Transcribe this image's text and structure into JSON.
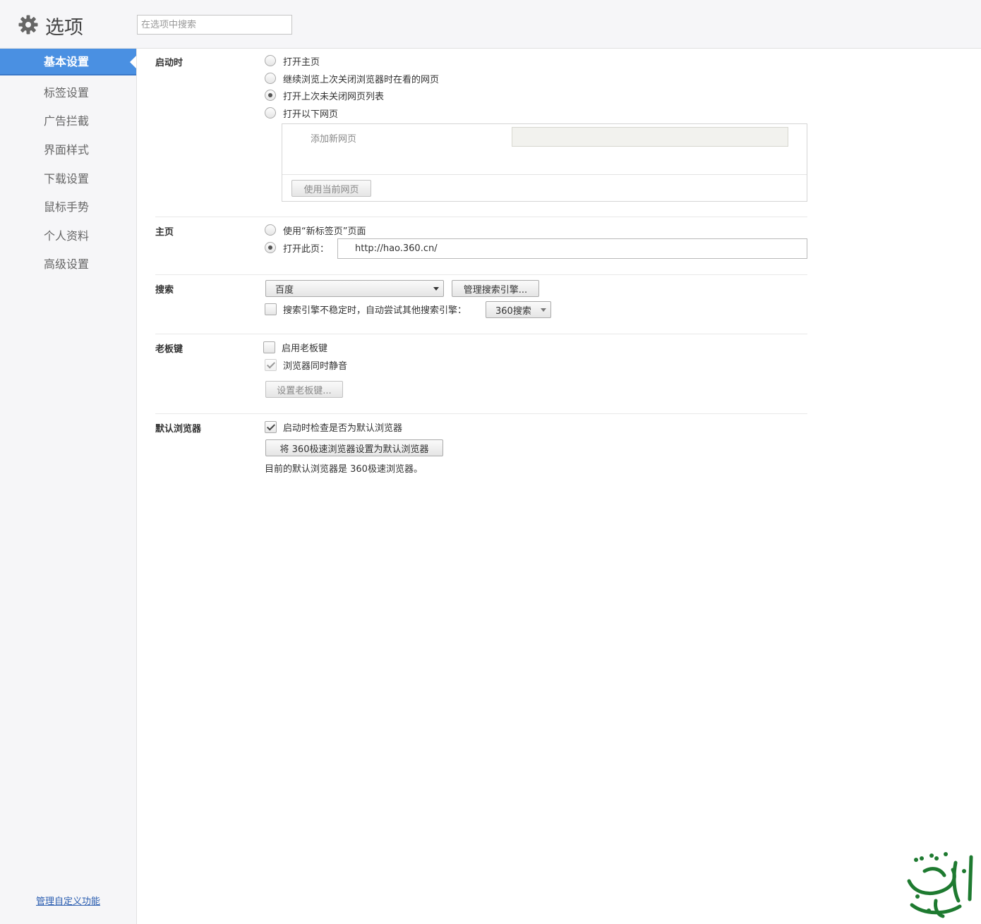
{
  "header": {
    "title": "选项",
    "search_placeholder": "在选项中搜索"
  },
  "sidebar": {
    "items": [
      {
        "label": "基本设置",
        "active": true
      },
      {
        "label": "标签设置"
      },
      {
        "label": "广告拦截"
      },
      {
        "label": "界面样式"
      },
      {
        "label": "下载设置"
      },
      {
        "label": "鼠标手势"
      },
      {
        "label": "个人资料"
      },
      {
        "label": "高级设置"
      }
    ],
    "manage_link": "管理自定义功能"
  },
  "startup": {
    "title": "启动时",
    "options": [
      "打开主页",
      "继续浏览上次关闭浏览器时在看的网页",
      "打开上次未关闭网页列表",
      "打开以下网页"
    ],
    "selected_option": "打开上次未关闭网页列表",
    "add_page_label": "添加新网页",
    "use_current_button": "使用当前网页"
  },
  "homepage": {
    "title": "主页",
    "option_newtab": "使用“新标签页”页面",
    "option_open": "打开此页：",
    "selected_option": "打开此页：",
    "url": "http://hao.360.cn/"
  },
  "search": {
    "title": "搜索",
    "engine": "百度",
    "manage_button": "管理搜索引擎...",
    "fallback_label": "搜索引擎不稳定时，自动尝试其他搜索引擎：",
    "fallback_checked": false,
    "fallback_engine": "360搜索"
  },
  "boss_key": {
    "title": "老板键",
    "enable_label": "启用老板键",
    "enable_checked": false,
    "mute_label": "浏览器同时静音",
    "mute_checked": true,
    "set_button": "设置老板键..."
  },
  "default_browser": {
    "title": "默认浏览器",
    "check_label": "启动时检查是否为默认浏览器",
    "check_checked": true,
    "set_button": "将 360极速浏览器设置为默认浏览器",
    "status": "目前的默认浏览器是 360极速浏览器。"
  },
  "colors": {
    "accent": "#4a90e2",
    "sidebar_bg": "#f6f6f8",
    "link": "#2a5db0",
    "watermark": "#1e7a30"
  }
}
